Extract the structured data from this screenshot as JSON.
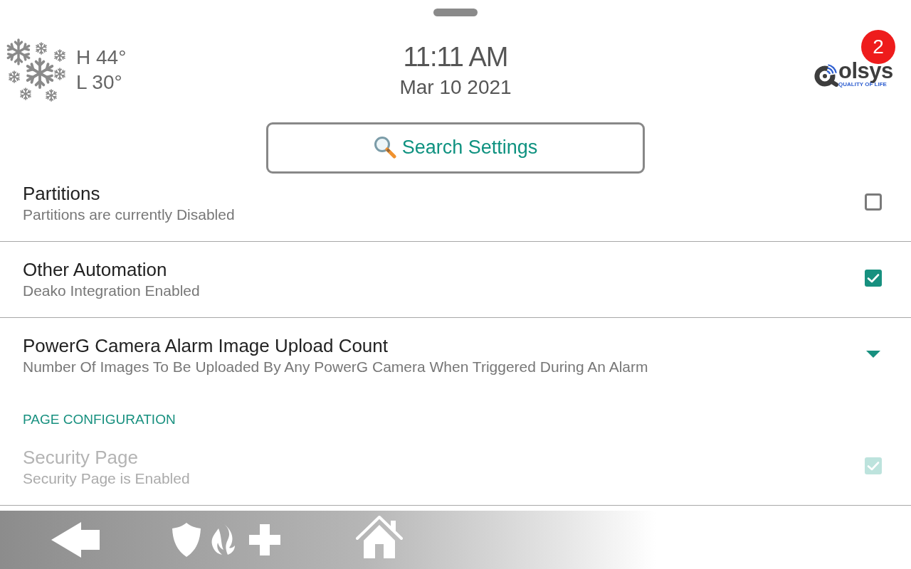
{
  "weather": {
    "high": "H 44°",
    "low": "L 30°"
  },
  "clock": {
    "time": "11:11 AM",
    "date": "Mar 10 2021"
  },
  "logo": {
    "wordmark": "olsys",
    "tagline": "QUALITY OF LIFE"
  },
  "notification_badge": "2",
  "search_button": {
    "label": "Search Settings"
  },
  "settings": [
    {
      "kind": "checkbox",
      "title": "Partitions",
      "subtitle": "Partitions are currently Disabled",
      "checked": false,
      "disabled": false
    },
    {
      "kind": "checkbox",
      "title": "Other Automation",
      "subtitle": "Deako Integration Enabled",
      "checked": true,
      "disabled": false
    },
    {
      "kind": "dropdown",
      "title": "PowerG Camera Alarm Image Upload Count",
      "subtitle": "Number Of Images To Be Uploaded By Any PowerG Camera When Triggered During An Alarm"
    },
    {
      "kind": "section",
      "title": "PAGE CONFIGURATION"
    },
    {
      "kind": "checkbox",
      "title": "Security Page",
      "subtitle": "Security Page is Enabled",
      "checked": true,
      "disabled": true
    }
  ]
}
